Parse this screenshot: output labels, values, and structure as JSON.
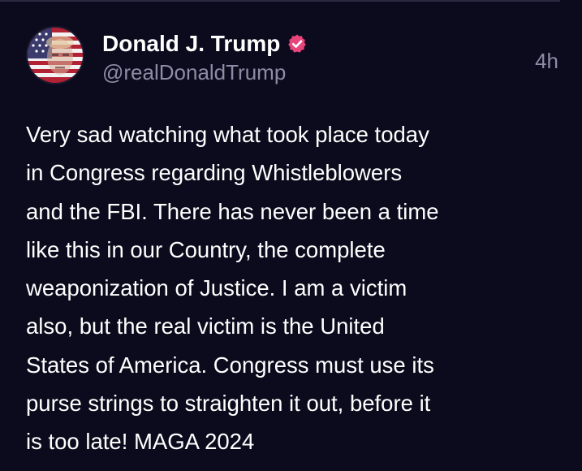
{
  "post": {
    "author": {
      "display_name": "Donald J. Trump",
      "handle": "@realDonaldTrump",
      "verified": true,
      "verified_badge_icon": "verified-badge-icon",
      "avatar_icon": "flag-portrait-avatar"
    },
    "timestamp": "4h",
    "body": "Very sad watching what took place today\nin Congress regarding Whistleblowers\nand the FBI. There has never been a time\nlike this in our Country, the complete\nweaponization of Justice. I am a victim\nalso, but the real victim is the United\nStates of America. Congress must use its\npurse strings to straighten it out, before it\nis too late! MAGA 2024"
  },
  "colors": {
    "background": "#0c0b1d",
    "text_primary": "#ffffff",
    "text_secondary": "#8e8ba6",
    "verified_badge": "#e8457a"
  }
}
